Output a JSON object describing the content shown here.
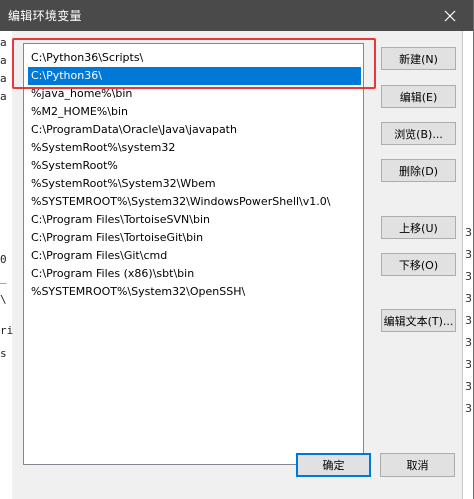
{
  "window": {
    "title": "编辑环境变量"
  },
  "background": {
    "left_chars": [
      "a",
      "a",
      "a",
      "a",
      "0",
      "_",
      "\\",
      "ri",
      "s"
    ],
    "right_chars": [
      "3",
      "3",
      "3",
      "3",
      "3",
      "3",
      "3",
      "3",
      "3"
    ]
  },
  "paths": [
    "C:\\Python36\\Scripts\\",
    "C:\\Python36\\",
    "%java_home%\\bin",
    "%M2_HOME%\\bin",
    "C:\\ProgramData\\Oracle\\Java\\javapath",
    "%SystemRoot%\\system32",
    "%SystemRoot%",
    "%SystemRoot%\\System32\\Wbem",
    "%SYSTEMROOT%\\System32\\WindowsPowerShell\\v1.0\\",
    "C:\\Program Files\\TortoiseSVN\\bin",
    "C:\\Program Files\\TortoiseGit\\bin",
    "C:\\Program Files\\Git\\cmd",
    "C:\\Program Files (x86)\\sbt\\bin",
    "%SYSTEMROOT%\\System32\\OpenSSH\\"
  ],
  "selected_index": 1,
  "buttons": {
    "new": "新建(N)",
    "edit": "编辑(E)",
    "browse": "浏览(B)...",
    "delete": "删除(D)",
    "move_up": "上移(U)",
    "move_down": "下移(O)",
    "edit_text": "编辑文本(T)...",
    "ok": "确定",
    "cancel": "取消"
  },
  "colors": {
    "selection": "#0078d7",
    "highlight_box": "#e8383b",
    "titlebar": "#4a4a4a"
  }
}
